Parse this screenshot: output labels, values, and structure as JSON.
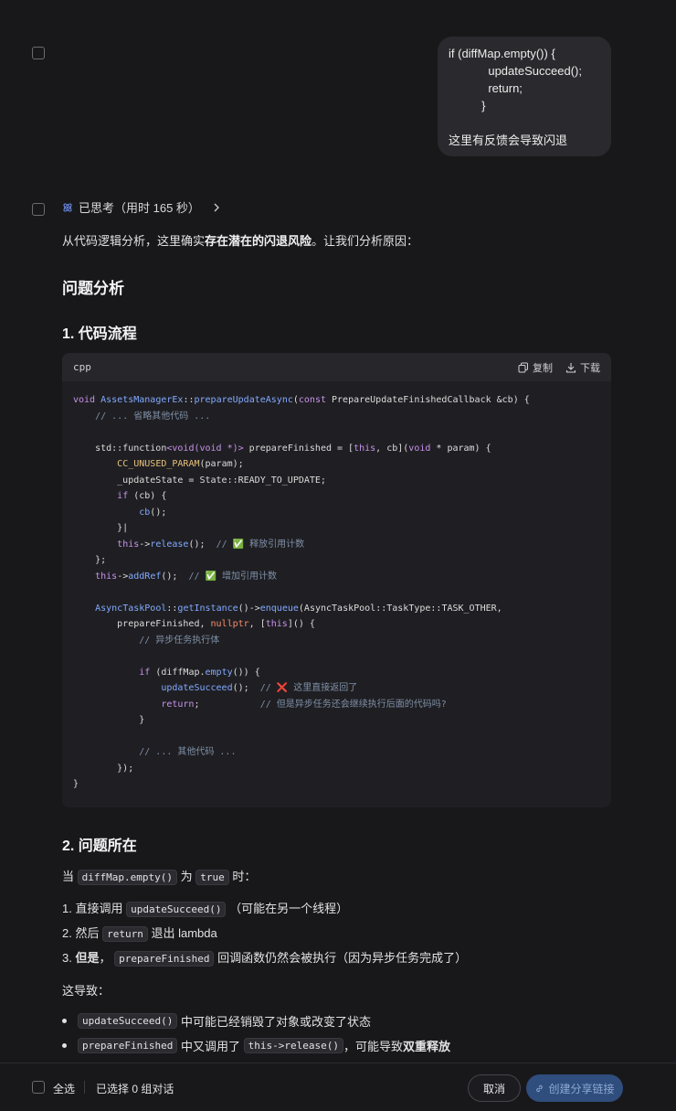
{
  "user_message": {
    "lines": [
      "if (diffMap.empty()) {",
      "            updateSucceed();",
      "            return;",
      "          }",
      "",
      "这里有反馈会导致闪退"
    ]
  },
  "thinking": {
    "label": "已思考（用时 165 秒）",
    "icon": "atom-icon"
  },
  "answer": {
    "intro_prefix": "从代码逻辑分析，这里确实",
    "intro_bold": "存在潜在的闪退风险",
    "intro_suffix": "。让我们分析原因：",
    "h_analysis": "问题分析",
    "h_flow": "1. 代码流程",
    "code": {
      "lang": "cpp",
      "copy_label": "复制",
      "download_label": "下载"
    },
    "h_issue": "2. 问题所在",
    "when_prefix": "当",
    "when_code1": "diffMap.empty()",
    "when_mid": "为",
    "when_code2": "true",
    "when_suffix": "时：",
    "steps": [
      {
        "num": "1.",
        "pre": "直接调用",
        "code": "updateSucceed()",
        "post": "（可能在另一个线程）"
      },
      {
        "num": "2.",
        "pre": "然后",
        "code": "return",
        "post": "退出 lambda"
      },
      {
        "num": "3.",
        "bold": "但是",
        "pre": "，",
        "code": "prepareFinished",
        "post": "回调函数仍然会被执行（因为异步任务完成了）"
      }
    ],
    "causes_label": "这导致：",
    "bullets": [
      {
        "code": "updateSucceed()",
        "post": "中可能已经销毁了对象或改变了状态"
      },
      {
        "code": "prepareFinished",
        "mid": "中又调用了",
        "code2": "this->release()",
        "post": "，可能导致",
        "bold": "双重释放"
      }
    ]
  },
  "footer": {
    "select_all": "全选",
    "selected_count": "已选择 0 组对话",
    "cancel": "取消",
    "share": "创建分享链接"
  }
}
